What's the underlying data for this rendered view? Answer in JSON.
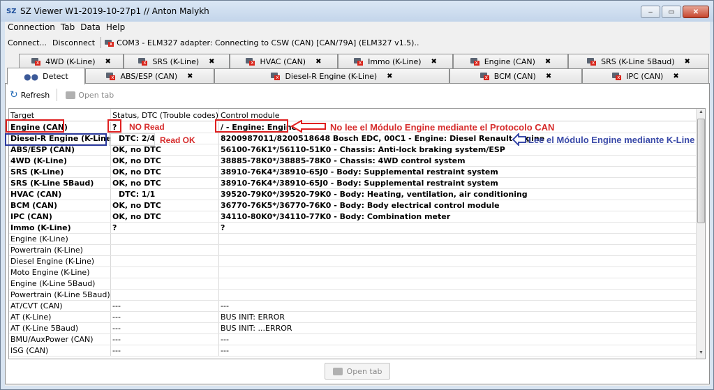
{
  "window": {
    "app_icon": "SZ",
    "title": "SZ Viewer W1-2019-10-27p1 // Anton Malykh",
    "buttons": {
      "minimize": "–",
      "maximize": "▭",
      "close": "✕"
    }
  },
  "menu": [
    "Connection",
    "Tab",
    "Data",
    "Help"
  ],
  "toolbar": {
    "connect": "Connect...",
    "disconnect": "Disconnect",
    "status": "COM3 - ELM327 adapter: Connecting to CSW (CAN) [CAN/79A] (ELM327 v1.5).."
  },
  "tabs_row1": [
    {
      "label": "4WD (K-Line)",
      "close": "✖"
    },
    {
      "label": "SRS (K-Line)",
      "close": "✖"
    },
    {
      "label": "HVAC (CAN)",
      "close": "✖"
    },
    {
      "label": "Immo (K-Line)",
      "close": "✖"
    },
    {
      "label": "Engine (CAN)",
      "close": "✖"
    },
    {
      "label": "SRS (K-Line 5Baud)",
      "close": "✖"
    }
  ],
  "tabs_row2": [
    {
      "label": "Detect",
      "close": ""
    },
    {
      "label": "ABS/ESP (CAN)",
      "close": "✖"
    },
    {
      "label": "Diesel-R Engine (K-Line)",
      "close": "✖"
    },
    {
      "label": "BCM (CAN)",
      "close": "✖"
    },
    {
      "label": "IPC (CAN)",
      "close": "✖"
    }
  ],
  "panel_toolbar": {
    "refresh": "Refresh",
    "open_tab": "Open tab"
  },
  "table": {
    "headers": [
      "Target",
      "Status, DTC (Trouble codes)",
      "Control module"
    ],
    "rows": [
      {
        "target": "Engine (CAN)",
        "status": "?",
        "module": "/ - Engine: Engine",
        "bold": true,
        "dtc": false
      },
      {
        "target": "Diesel-R Engine (K-Line)",
        "status": "DTC: 2/4",
        "module": "8200987011/8200518648 Bosch EDC, 00C1 - Engine: Diesel Renault engine",
        "bold": true,
        "dtc": true
      },
      {
        "target": "ABS/ESP (CAN)",
        "status": "OK, no DTC",
        "module": "56100-76K1*/56110-51K0 - Chassis: Anti-lock braking system/ESP",
        "bold": true,
        "dtc": false
      },
      {
        "target": "4WD (K-Line)",
        "status": "OK, no DTC",
        "module": "38885-78K0*/38885-78K0 - Chassis: 4WD control system",
        "bold": true,
        "dtc": false
      },
      {
        "target": "SRS (K-Line)",
        "status": "OK, no DTC",
        "module": "38910-76K4*/38910-65J0 - Body: Supplemental restraint system",
        "bold": true,
        "dtc": false
      },
      {
        "target": "SRS (K-Line 5Baud)",
        "status": "OK, no DTC",
        "module": "38910-76K4*/38910-65J0 - Body: Supplemental restraint system",
        "bold": true,
        "dtc": false
      },
      {
        "target": "HVAC (CAN)",
        "status": "DTC: 1/1",
        "module": "39520-79K0*/39520-79K0 - Body: Heating, ventilation, air conditioning",
        "bold": true,
        "dtc": true
      },
      {
        "target": "BCM (CAN)",
        "status": "OK, no DTC",
        "module": "36770-76K5*/36770-76K0 - Body: Body electrical control module",
        "bold": true,
        "dtc": false
      },
      {
        "target": "IPC (CAN)",
        "status": "OK, no DTC",
        "module": "34110-80K0*/34110-77K0 - Body: Combination meter",
        "bold": true,
        "dtc": false
      },
      {
        "target": "Immo (K-Line)",
        "status": "?",
        "module": "?",
        "bold": true,
        "dtc": false
      },
      {
        "target": "Engine (K-Line)",
        "status": "",
        "module": "",
        "bold": false,
        "dtc": false
      },
      {
        "target": "Powertrain (K-Line)",
        "status": "",
        "module": "",
        "bold": false,
        "dtc": false
      },
      {
        "target": "Diesel Engine (K-Line)",
        "status": "",
        "module": "",
        "bold": false,
        "dtc": false
      },
      {
        "target": "Moto Engine (K-Line)",
        "status": "",
        "module": "",
        "bold": false,
        "dtc": false
      },
      {
        "target": "Engine (K-Line 5Baud)",
        "status": "",
        "module": "",
        "bold": false,
        "dtc": false
      },
      {
        "target": "Powertrain (K-Line 5Baud)",
        "status": "",
        "module": "",
        "bold": false,
        "dtc": false
      },
      {
        "target": "AT/CVT (CAN)",
        "status": "---",
        "module": "---",
        "bold": false,
        "dtc": false
      },
      {
        "target": "AT (K-Line)",
        "status": "---",
        "module": "BUS INIT: ERROR",
        "bold": false,
        "dtc": false
      },
      {
        "target": "AT (K-Line 5Baud)",
        "status": "---",
        "module": "BUS INIT: ...ERROR",
        "bold": false,
        "dtc": false
      },
      {
        "target": "BMU/AuxPower (CAN)",
        "status": "---",
        "module": "---",
        "bold": false,
        "dtc": false
      },
      {
        "target": "ISG (CAN)",
        "status": "---",
        "module": "---",
        "bold": false,
        "dtc": false
      }
    ]
  },
  "bottom_button": "Open tab",
  "annotations": {
    "no_read": "NO Read",
    "read_ok": "Read OK",
    "can_note": "No lee el Módulo Engine mediante el Protocolo CAN",
    "kline_note": "Lee el Módulo Engine mediante K-Line"
  },
  "colors": {
    "annotation_red": "#e02020",
    "annotation_blue": "#2b3a9e",
    "close_button": "#c8452d"
  }
}
